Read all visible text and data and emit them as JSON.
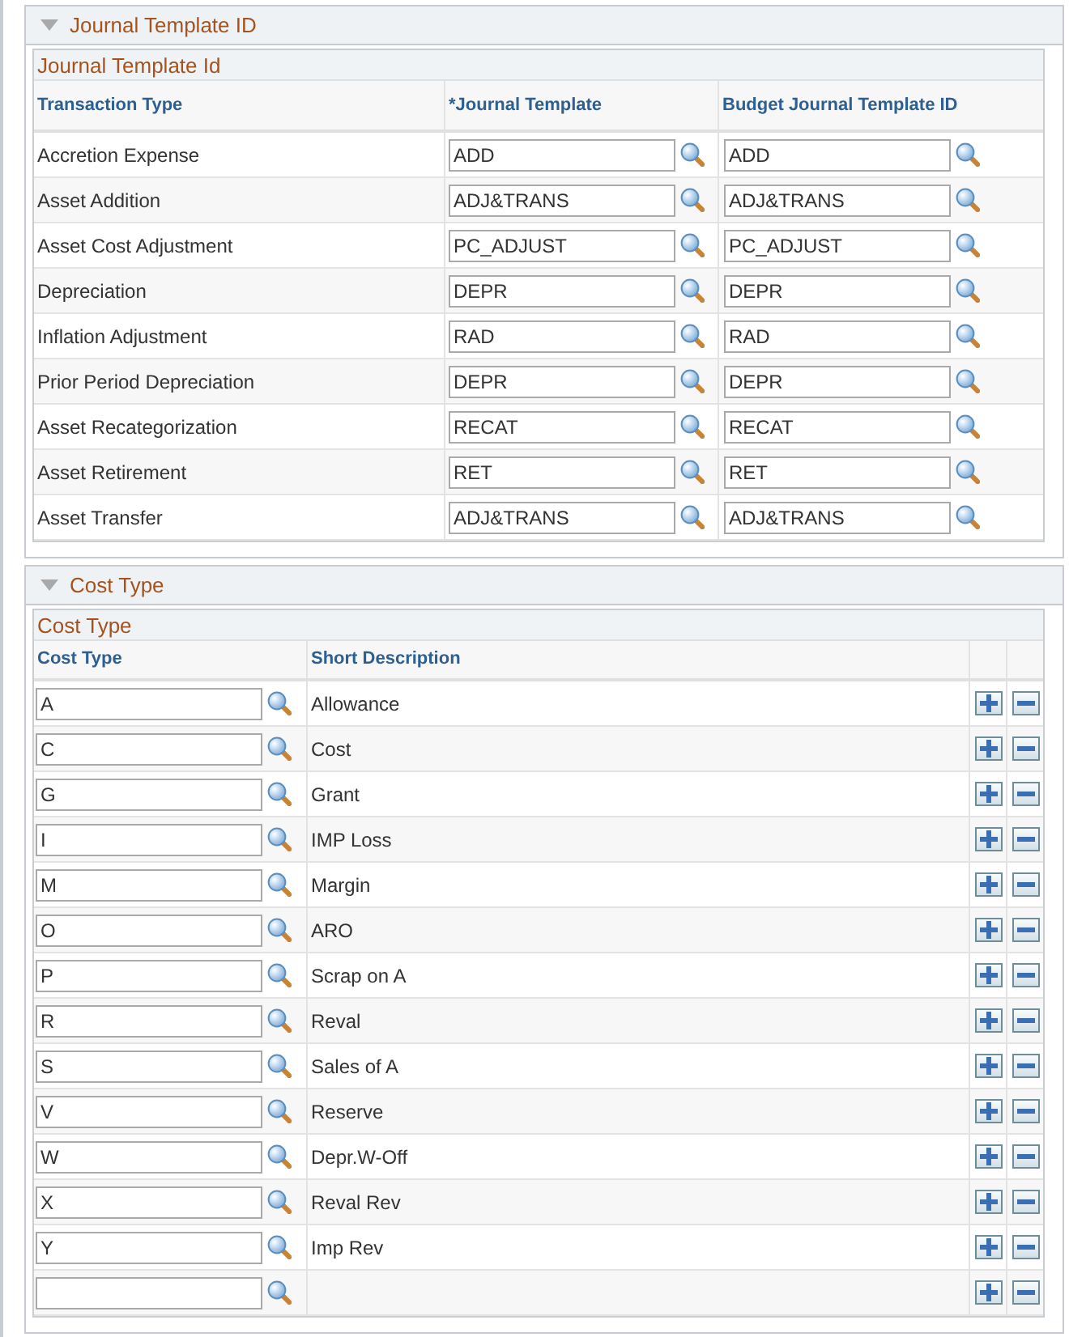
{
  "journal_template_section": {
    "title": "Journal Template ID",
    "expanded": true,
    "grid": {
      "title": "Journal Template Id",
      "columns": [
        "Transaction Type",
        "*Journal Template",
        "Budget Journal Template ID"
      ],
      "rows": [
        {
          "transaction_type": "Accretion Expense",
          "journal_template": "ADD",
          "budget_journal_template_id": "ADD"
        },
        {
          "transaction_type": "Asset Addition",
          "journal_template": "ADJ&TRANS",
          "budget_journal_template_id": "ADJ&TRANS"
        },
        {
          "transaction_type": "Asset Cost Adjustment",
          "journal_template": "PC_ADJUST",
          "budget_journal_template_id": "PC_ADJUST"
        },
        {
          "transaction_type": "Depreciation",
          "journal_template": "DEPR",
          "budget_journal_template_id": "DEPR"
        },
        {
          "transaction_type": "Inflation Adjustment",
          "journal_template": "RAD",
          "budget_journal_template_id": "RAD"
        },
        {
          "transaction_type": "Prior Period Depreciation",
          "journal_template": "DEPR",
          "budget_journal_template_id": "DEPR"
        },
        {
          "transaction_type": "Asset Recategorization",
          "journal_template": "RECAT",
          "budget_journal_template_id": "RECAT"
        },
        {
          "transaction_type": "Asset Retirement",
          "journal_template": "RET",
          "budget_journal_template_id": "RET"
        },
        {
          "transaction_type": "Asset Transfer",
          "journal_template": "ADJ&TRANS",
          "budget_journal_template_id": "ADJ&TRANS"
        }
      ]
    }
  },
  "cost_type_section": {
    "title": "Cost Type",
    "expanded": true,
    "grid": {
      "title": "Cost Type",
      "columns": [
        "Cost Type",
        "Short Description"
      ],
      "rows": [
        {
          "cost_type": "A",
          "short_description": "Allowance"
        },
        {
          "cost_type": "C",
          "short_description": "Cost"
        },
        {
          "cost_type": "G",
          "short_description": "Grant"
        },
        {
          "cost_type": "I",
          "short_description": "IMP Loss"
        },
        {
          "cost_type": "M",
          "short_description": "Margin"
        },
        {
          "cost_type": "O",
          "short_description": "ARO"
        },
        {
          "cost_type": "P",
          "short_description": "Scrap on A"
        },
        {
          "cost_type": "R",
          "short_description": "Reval"
        },
        {
          "cost_type": "S",
          "short_description": "Sales of A"
        },
        {
          "cost_type": "V",
          "short_description": "Reserve"
        },
        {
          "cost_type": "W",
          "short_description": "Depr.W-Off"
        },
        {
          "cost_type": "X",
          "short_description": "Reval Rev"
        },
        {
          "cost_type": "Y",
          "short_description": "Imp Rev"
        },
        {}
      ]
    }
  }
}
